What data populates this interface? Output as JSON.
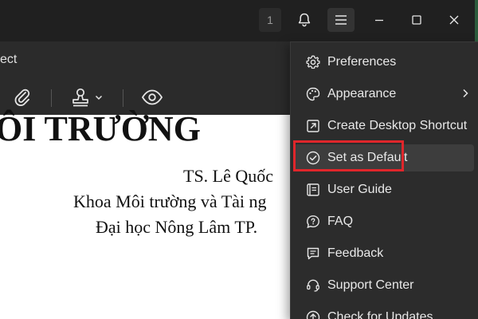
{
  "titlebar": {
    "notification_count": "1",
    "icons": [
      "bell-icon",
      "hamburger-menu-icon",
      "minimize-icon",
      "maximize-icon",
      "close-icon"
    ]
  },
  "toolbar": {
    "tab_fragment": "ect",
    "tools": [
      "paperclip-icon",
      "stamp-icon",
      "chevron-down-icon",
      "eye-icon"
    ]
  },
  "document": {
    "heading": "ÔI TRƯỜNG",
    "lines": [
      "TS. Lê Quốc",
      "Khoa Môi trường và Tài ng",
      "Đại học Nông Lâm TP."
    ]
  },
  "menu": {
    "items": [
      {
        "label": "Preferences",
        "icon": "gear-icon"
      },
      {
        "label": "Appearance",
        "icon": "palette-icon",
        "submenu": true
      },
      {
        "label": "Create Desktop Shortcut",
        "icon": "shortcut-icon"
      },
      {
        "label": "Set as Default",
        "icon": "check-circle-icon",
        "highlighted": true
      },
      {
        "label": "User Guide",
        "icon": "guide-icon"
      },
      {
        "label": "FAQ",
        "icon": "faq-icon"
      },
      {
        "label": "Feedback",
        "icon": "feedback-icon"
      },
      {
        "label": "Support Center",
        "icon": "headset-icon"
      },
      {
        "label": "Check for Updates",
        "icon": "update-icon"
      }
    ]
  },
  "colors": {
    "titlebar_bg": "#202020",
    "toolbar_bg": "#2b2b2b",
    "menu_bg": "#2c2c2c",
    "highlight_border": "#e0262b",
    "menu_text": "#e9e9e9"
  }
}
